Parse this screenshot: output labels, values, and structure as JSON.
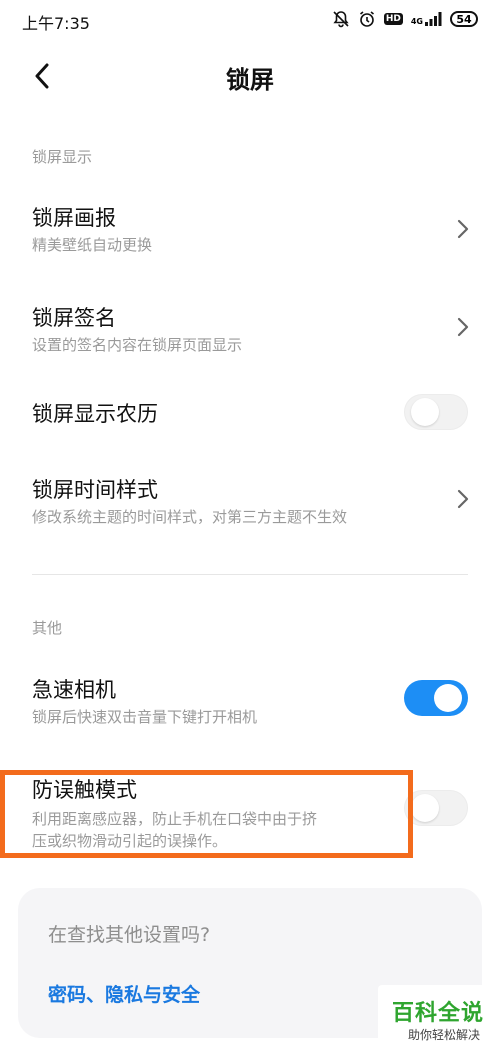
{
  "status_bar": {
    "time": "上午7:35",
    "hd_label": "HD",
    "network_label": "4G",
    "battery": "54"
  },
  "header": {
    "title": "锁屏"
  },
  "sections": {
    "lock_display": {
      "label": "锁屏显示",
      "items": [
        {
          "title": "锁屏画报",
          "subtitle": "精美壁纸自动更换"
        },
        {
          "title": "锁屏签名",
          "subtitle": "设置的签名内容在锁屏页面显示"
        },
        {
          "title": "锁屏显示农历",
          "toggle": false
        },
        {
          "title": "锁屏时间样式",
          "subtitle": "修改系统主题的时间样式，对第三方主题不生效"
        }
      ]
    },
    "other": {
      "label": "其他",
      "items": [
        {
          "title": "急速相机",
          "subtitle": "锁屏后快速双击音量下键打开相机",
          "toggle": true
        },
        {
          "title": "防误触模式",
          "subtitle_line1": "利用距离感应器，防止手机在口袋中由于挤",
          "subtitle_line2": "压或织物滑动引起的误操作。",
          "toggle": false
        }
      ]
    }
  },
  "card": {
    "question": "在查找其他设置吗?",
    "link": "密码、隐私与安全"
  },
  "watermark": {
    "title": "百科全说",
    "subtitle": "助你轻松解决"
  },
  "colors": {
    "accent": "#1d8ef5",
    "link": "#1a79e0",
    "highlight": "#f36b1c",
    "watermark_green": "#2fa52f"
  }
}
